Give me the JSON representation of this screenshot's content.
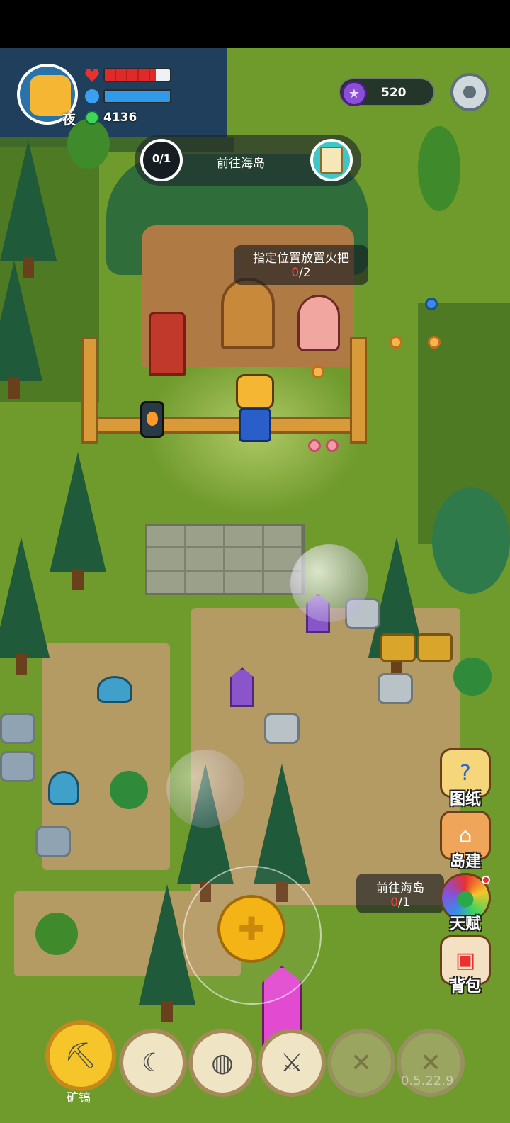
{
  "player": {
    "name_tag": "夜",
    "hp_fill_fraction": 0.78,
    "energy_fill_fraction": 1.0,
    "gems": "4136"
  },
  "currency": {
    "amount": "520",
    "icon": "star-coin-icon"
  },
  "quest": {
    "progress": "0/1",
    "text": "前往海岛",
    "reward_icon": "note-reward-icon"
  },
  "objective": {
    "title": "指定位置放置火把",
    "current": "0",
    "total": "/2"
  },
  "side_quest": {
    "title": "前往海岛",
    "current": "0",
    "total": "/1"
  },
  "side_menu": [
    {
      "label": "图纸",
      "icon": "blueprint-icon",
      "glyph": "?"
    },
    {
      "label": "岛建",
      "icon": "house-build-icon",
      "glyph": "⌂"
    },
    {
      "label": "天赋",
      "icon": "talent-orb-icon",
      "glyph": "●",
      "has_badge": true
    },
    {
      "label": "背包",
      "icon": "backpack-icon",
      "glyph": "▣"
    }
  ],
  "toolbar": {
    "selected_label": "矿镐",
    "tools": [
      {
        "name": "pickaxe",
        "glyph": "⛏"
      },
      {
        "name": "sickle",
        "glyph": "☾"
      },
      {
        "name": "net",
        "glyph": "◍"
      },
      {
        "name": "sword",
        "glyph": "⚔"
      },
      {
        "name": "locked-1",
        "glyph": "✕"
      },
      {
        "name": "locked-2",
        "glyph": "✕"
      }
    ]
  },
  "version": "0.5.22.9",
  "colors": {
    "hp": "#e02a2a",
    "energy": "#2f9ae8",
    "progress_red": "#ff4a3a",
    "joystick": "#f5b416"
  }
}
